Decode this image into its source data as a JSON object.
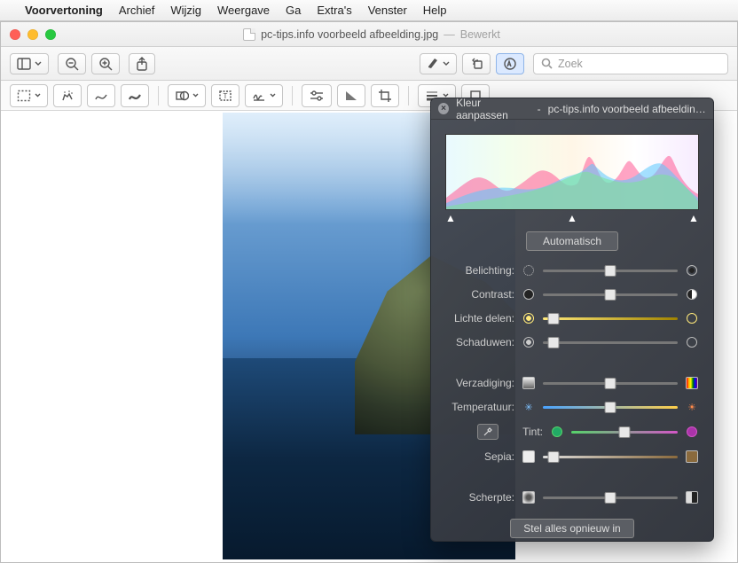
{
  "menubar": {
    "app": "Voorvertoning",
    "items": [
      "Archief",
      "Wijzig",
      "Weergave",
      "Ga",
      "Extra's",
      "Venster",
      "Help"
    ]
  },
  "window": {
    "doc_title": "pc-tips.info voorbeeld afbeelding.jpg",
    "status": "Bewerkt"
  },
  "search": {
    "placeholder": "Zoek"
  },
  "panel": {
    "title_prefix": "Kleur aanpassen",
    "title_doc": "pc-tips.info voorbeeld afbeelding.jpg",
    "auto_label": "Automatisch",
    "reset_label": "Stel alles opnieuw in",
    "sliders": {
      "exposure": {
        "label": "Belichting:",
        "value": 50,
        "track": "#777"
      },
      "contrast": {
        "label": "Contrast:",
        "value": 50,
        "track": "#777"
      },
      "highlights": {
        "label": "Lichte delen:",
        "value": 8,
        "track": "linear-gradient(90deg,#ffe97a,#a08300)"
      },
      "shadows": {
        "label": "Schaduwen:",
        "value": 8,
        "track": "#777"
      },
      "saturation": {
        "label": "Verzadiging:",
        "value": 50,
        "track": "#777"
      },
      "temperature": {
        "label": "Temperatuur:",
        "value": 50,
        "track": "linear-gradient(90deg,#4aa3ff,#ffcf4a)"
      },
      "tint": {
        "label": "Tint:",
        "value": 50,
        "track": "linear-gradient(90deg,#56d36a,#d356c7)"
      },
      "sepia": {
        "label": "Sepia:",
        "value": 8,
        "track": "linear-gradient(90deg,#ddd,#8a6a3d)"
      },
      "sharpness": {
        "label": "Scherpte:",
        "value": 50,
        "track": "#777"
      }
    }
  }
}
